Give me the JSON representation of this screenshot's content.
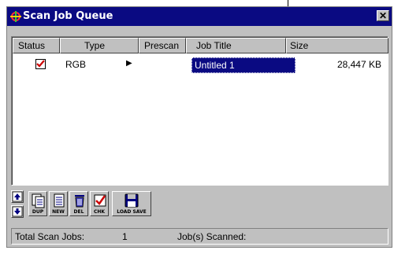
{
  "window": {
    "title": "Scan Job Queue",
    "close_glyph": "✕"
  },
  "columns": [
    "Status",
    "Type",
    "Prescan",
    "Job Title",
    "Size"
  ],
  "jobs": [
    {
      "status_checked": true,
      "type": "RGB",
      "prescan_glyph": "▶",
      "title": "Untitled 1",
      "size": "28,447 KB"
    }
  ],
  "toolbar": {
    "move_up_icon": "arrow-up-icon",
    "move_down_icon": "arrow-down-icon",
    "buttons": [
      {
        "label": "DUP",
        "icon": "duplicate-icon"
      },
      {
        "label": "NEW",
        "icon": "new-document-icon"
      },
      {
        "label": "DEL",
        "icon": "trash-icon"
      },
      {
        "label": "CHK",
        "icon": "check-icon"
      },
      {
        "label": "LOAD SAVE",
        "icon": "floppy-disk-icon"
      }
    ]
  },
  "status": {
    "total_label": "Total Scan Jobs:",
    "total_value": "1",
    "scanned_label": "Job(s) Scanned:",
    "scanned_value": ""
  },
  "colors": {
    "titlebar": "#0a0a82",
    "selection": "#0a0a82",
    "check_mark": "#cc0000",
    "face": "#c0c0c0"
  }
}
